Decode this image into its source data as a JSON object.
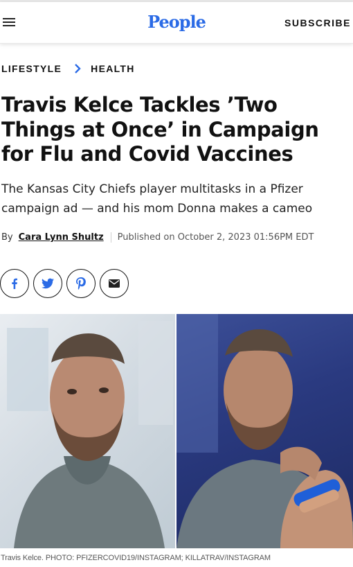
{
  "header": {
    "logo": "People",
    "subscribe_label": "SUBSCRIBE",
    "brand_color": "#2b6be6"
  },
  "breadcrumb": {
    "items": [
      "LIFESTYLE",
      "HEALTH"
    ],
    "separator_color": "#2b6be6"
  },
  "article": {
    "title": "Travis Kelce Tackles ’Two Things at Once’ in Campaign for Flu and Covid Vaccines",
    "dek": "The Kansas City Chiefs player multitasks in a Pfizer campaign ad — and his mom Donna makes a cameo",
    "byline_prefix": "By",
    "author": "Cara Lynn Shultz",
    "published": "Published on October 2, 2023 01:56PM EDT"
  },
  "share": {
    "buttons": [
      {
        "name": "facebook",
        "icon": "facebook-icon"
      },
      {
        "name": "twitter",
        "icon": "twitter-icon"
      },
      {
        "name": "pinterest",
        "icon": "pinterest-icon"
      },
      {
        "name": "email",
        "icon": "email-icon"
      }
    ],
    "icon_color": "#2b6be6"
  },
  "image": {
    "caption": "Travis Kelce. PHOTO: PFIZERCOVID19/INSTAGRAM; KILLATRAV/INSTAGRAM"
  }
}
